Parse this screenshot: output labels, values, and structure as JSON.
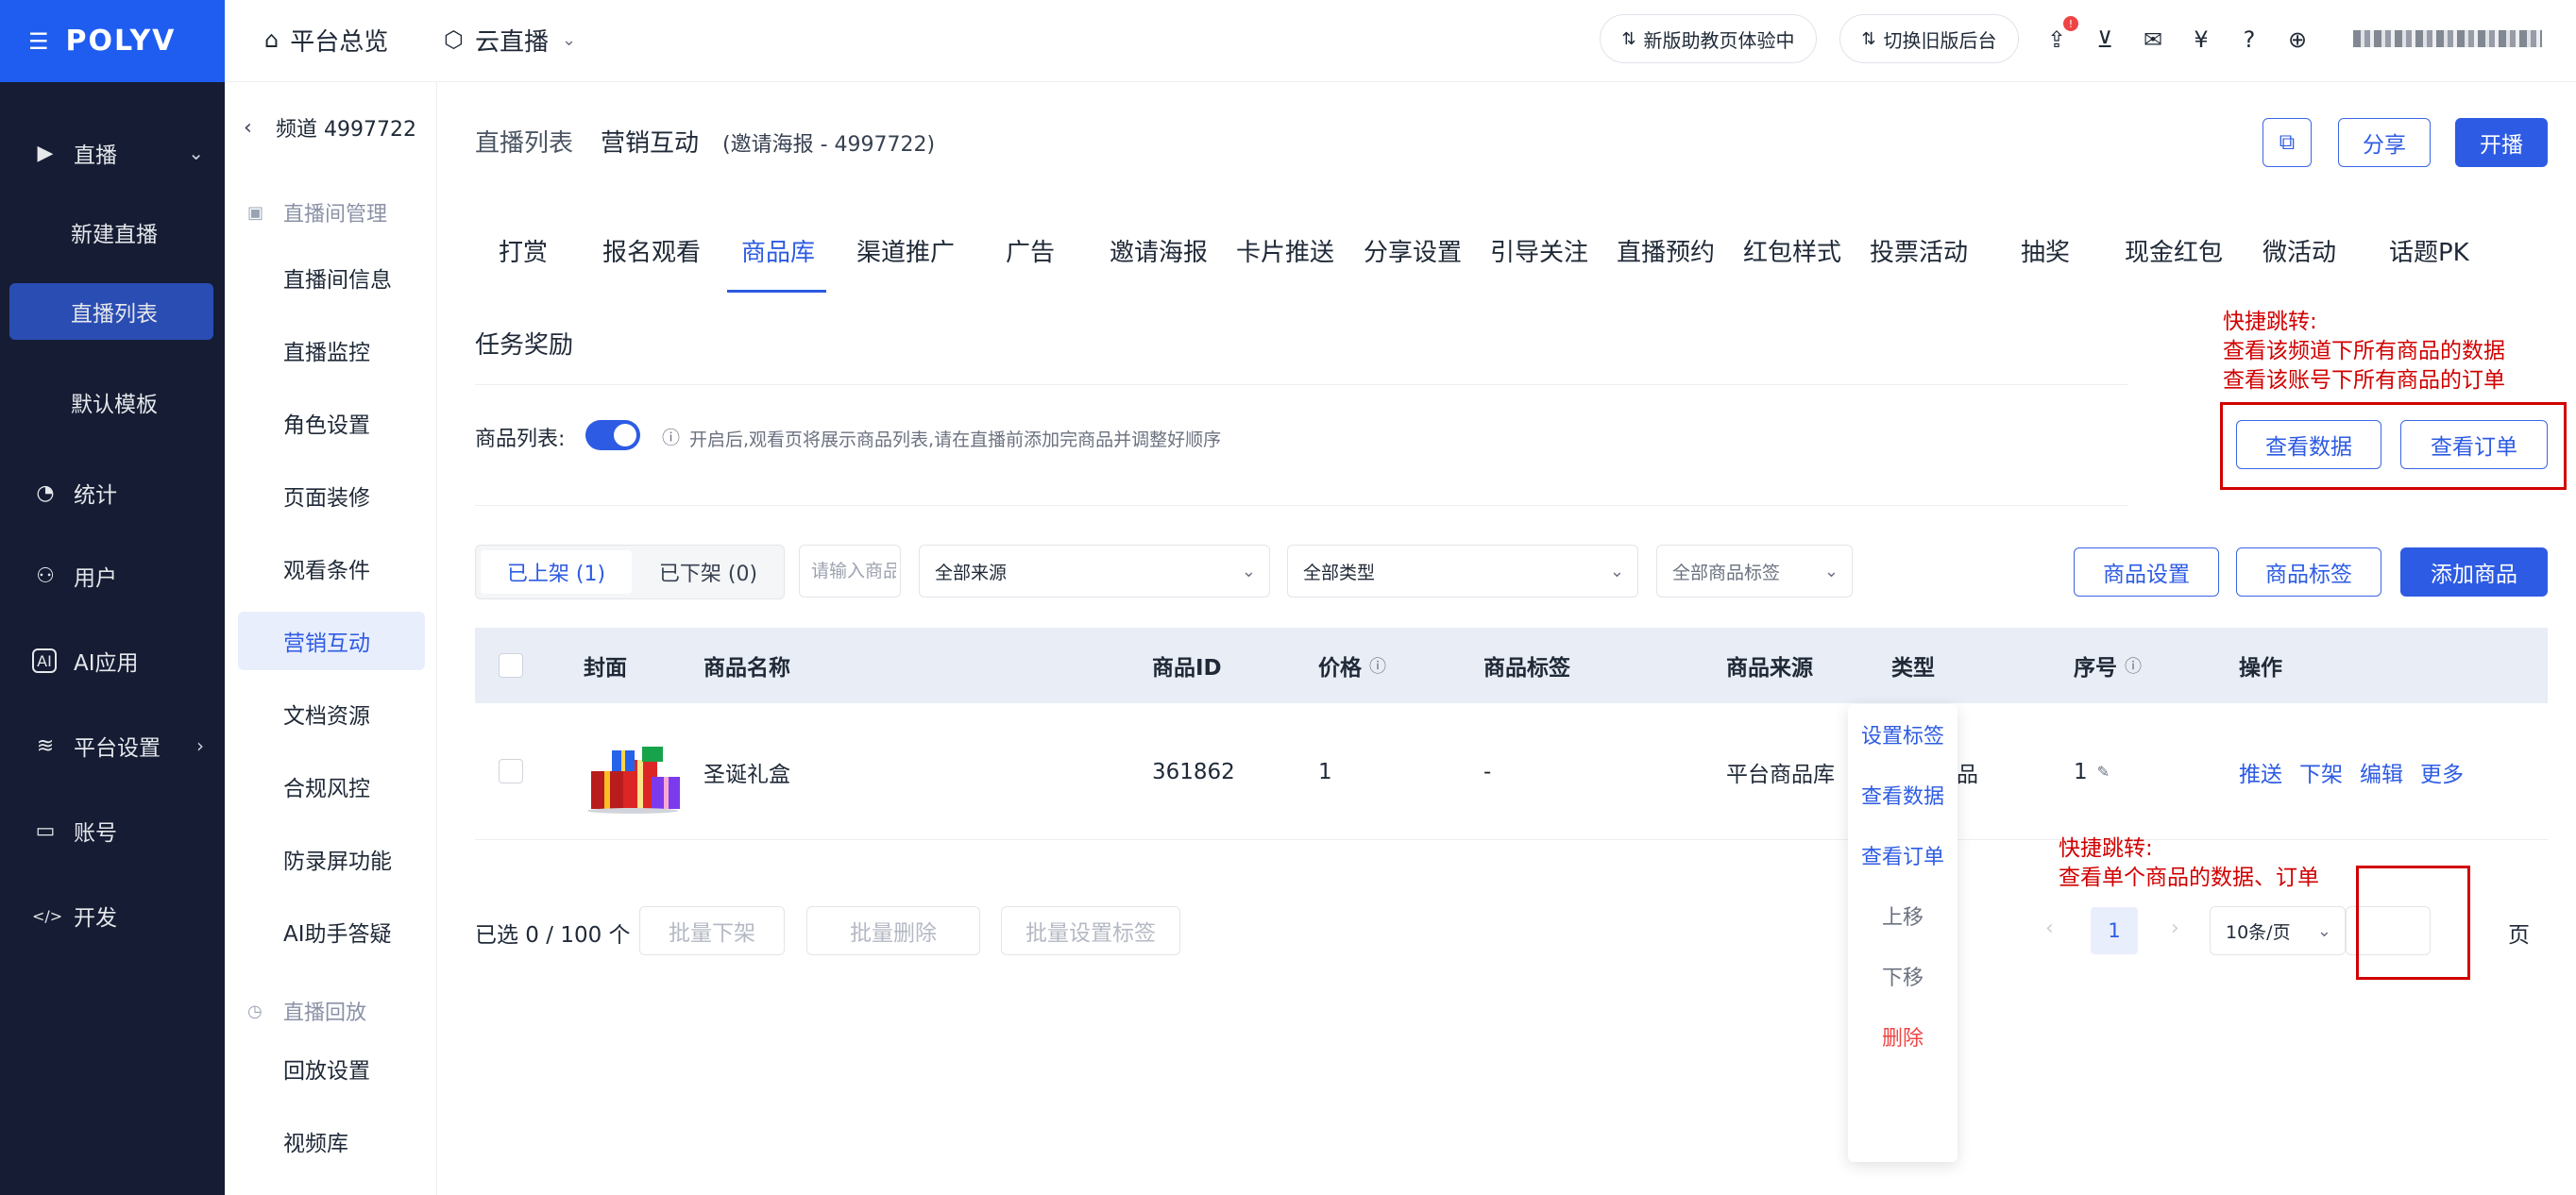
{
  "brand": {
    "name": "POLYV"
  },
  "leftnav": {
    "items": [
      {
        "label": "直播",
        "icon": "video-icon"
      },
      {
        "label": "新建直播"
      },
      {
        "label": "直播列表"
      },
      {
        "label": "默认模板"
      },
      {
        "label": "统计",
        "icon": "chart-icon"
      },
      {
        "label": "用户",
        "icon": "user-icon"
      },
      {
        "label": "AI应用",
        "icon": "ai-icon"
      },
      {
        "label": "平台设置",
        "icon": "layers-icon"
      },
      {
        "label": "账号",
        "icon": "id-card-icon"
      },
      {
        "label": "开发",
        "icon": "code-icon"
      }
    ]
  },
  "secnav": {
    "channel": "频道 4997722",
    "group1": "直播间管理",
    "items": [
      "直播间信息",
      "直播监控",
      "角色设置",
      "页面装修",
      "观看条件",
      "营销互动",
      "文档资源",
      "合规风控",
      "防录屏功能",
      "AI助手答疑"
    ],
    "group2": "直播回放",
    "items2": [
      "回放设置",
      "视频库"
    ]
  },
  "topbar": {
    "overview": "平台总览",
    "cloud_live": "云直播",
    "pill1": "新版助教页体验中",
    "pill2": "切换旧版后台",
    "badge": "!"
  },
  "main": {
    "crumb1": "直播列表",
    "crumb_sep": "/",
    "crumb2": "营销互动",
    "crumb3": "(邀请海报 - 4997722)",
    "share_btn": "分享",
    "start_btn": "开播",
    "tabs": [
      "打赏",
      "报名观看",
      "商品库",
      "渠道推广",
      "广告",
      "邀请海报",
      "卡片推送",
      "分享设置",
      "引导关注",
      "直播预约",
      "红包样式",
      "投票活动",
      "抽奖",
      "现金红包",
      "微活动",
      "话题PK"
    ],
    "section_title": "任务奖励",
    "list_label": "商品列表:",
    "list_hint": "开启后,观看页将展示商品列表,请在直播前添加完商品并调整好顺序",
    "view_data_btn": "查看数据",
    "view_orders_btn": "查看订单",
    "seg_on": "已上架 (1)",
    "seg_off": "已下架 (0)",
    "search_placeholder": "请输入商品",
    "filter_source": "全部来源",
    "filter_type": "全部类型",
    "filter_tag": "全部商品标签",
    "goods_settings_btn": "商品设置",
    "goods_tag_btn": "商品标签",
    "add_goods_btn": "添加商品",
    "columns": [
      "封面",
      "商品名称",
      "商品ID",
      "价格",
      "商品标签",
      "商品来源",
      "类型",
      "序号",
      "操作"
    ],
    "row": {
      "name": "圣诞礼盒",
      "id": "361862",
      "price": "1",
      "tag": "-",
      "source": "平台商品库",
      "type": "普通产品",
      "order": "1",
      "actions": [
        "推送",
        "下架",
        "编辑",
        "更多"
      ]
    },
    "selected": "已选 0 / 100 个",
    "batch_off": "批量下架",
    "batch_delete": "批量删除",
    "batch_tag": "批量设置标签",
    "page": "1",
    "page_size": "10条/页",
    "page_suffix": "页",
    "more_menu": [
      "设置标签",
      "查看数据",
      "查看订单",
      "上移",
      "下移",
      "删除"
    ]
  },
  "annotations": {
    "top_title": "快捷跳转:",
    "top_line1": "查看该频道下所有商品的数据",
    "top_line2": "查看该账号下所有商品的订单",
    "bottom_title": "快捷跳转:",
    "bottom_line1": "查看单个商品的数据、订单"
  },
  "colors": {
    "brand_blue": "#1f5df0",
    "primary": "#2d5be3",
    "nav_bg": "#151c33",
    "annotation_red": "#d10000",
    "danger": "#ef4444"
  }
}
